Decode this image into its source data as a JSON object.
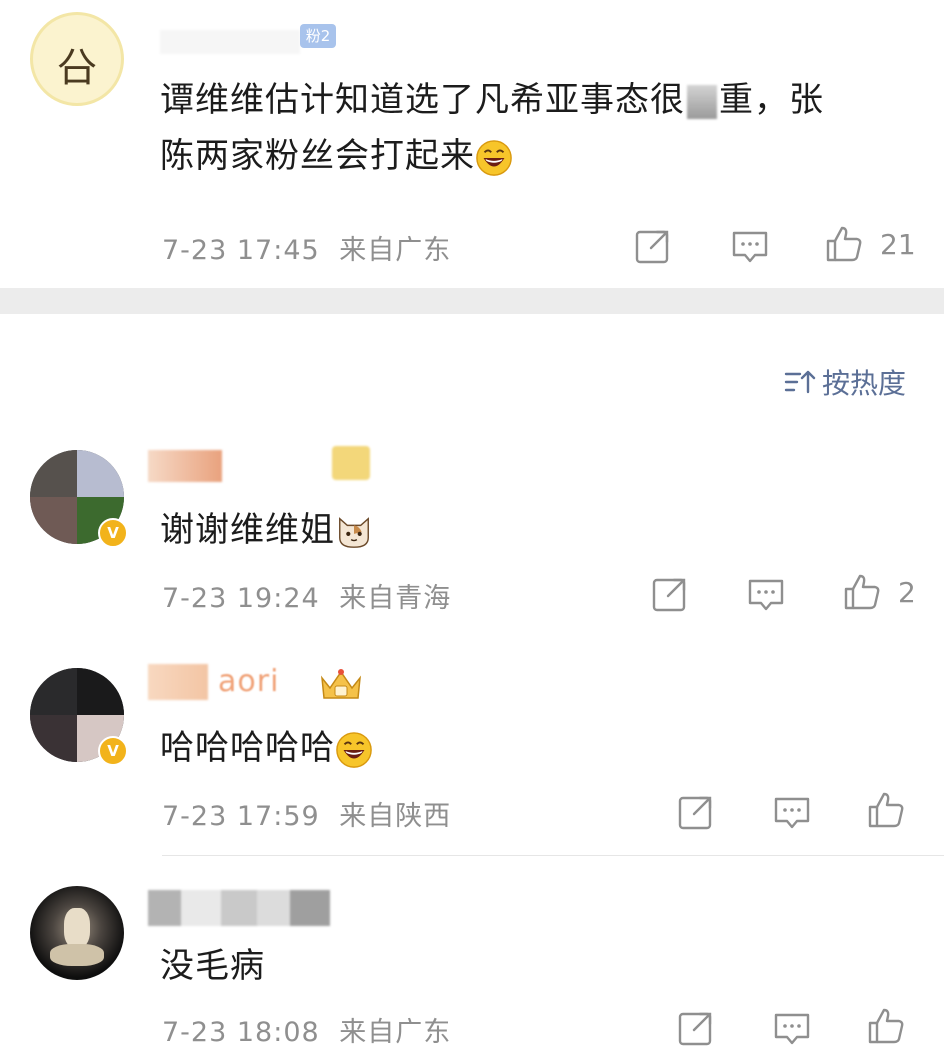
{
  "top_comment": {
    "fan_badge": "粉2",
    "text_line1": "谭维维估计知道选了凡希亚事态很",
    "text_line1_end": "重，张",
    "text_line2": "陈两家粉丝会打起来",
    "time": "7-23 17:45",
    "location": "来自广东",
    "likes": "21",
    "emoji_icon": "laughing-face",
    "avatar_glyph": "㕣"
  },
  "sort_label": "按热度",
  "comments": [
    {
      "text": "谢谢维维姐",
      "time": "7-23 19:24",
      "location": "来自青海",
      "likes": "2",
      "emoji_icon": "cat-face",
      "verified_mark": "V"
    },
    {
      "username_fragment": "aori",
      "text": "哈哈哈哈哈",
      "time": "7-23 17:59",
      "location": "来自陕西",
      "likes": "",
      "emoji_icon": "laughing-face",
      "verified_mark": "V"
    },
    {
      "text": "没毛病",
      "time": "7-23 18:08",
      "location": "来自广东",
      "likes": ""
    }
  ],
  "colors": {
    "accent_blue": "#5b6f96",
    "meta_gray": "#8f8f8f",
    "divider_gray": "#ececec",
    "verified_gold": "#f2b31b"
  }
}
